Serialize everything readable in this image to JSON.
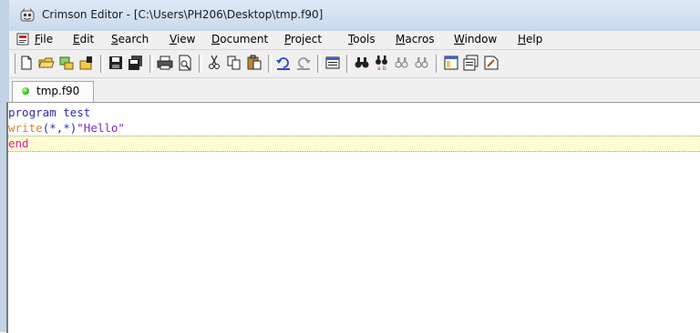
{
  "window": {
    "title": "Crimson Editor - [C:\\Users\\PH206\\Desktop\\tmp.f90]"
  },
  "menu": [
    {
      "label": "File",
      "accel": "F",
      "rest": "ile"
    },
    {
      "label": "Edit",
      "accel": "E",
      "rest": "dit"
    },
    {
      "label": "Search",
      "accel": "S",
      "rest": "earch"
    },
    {
      "label": "View",
      "accel": "V",
      "rest": "iew"
    },
    {
      "label": "Document",
      "accel": "D",
      "rest": "ocument"
    },
    {
      "label": "Project",
      "accel": "P",
      "rest": "roject"
    },
    {
      "label": "Tools",
      "accel": "T",
      "rest": "ools"
    },
    {
      "label": "Macros",
      "accel": "M",
      "rest": "acros"
    },
    {
      "label": "Window",
      "accel": "W",
      "rest": "indow"
    },
    {
      "label": "Help",
      "accel": "H",
      "rest": "elp"
    }
  ],
  "toolbar": {
    "icons": [
      "new-file-icon",
      "open-folder-icon",
      "open-remote-icon",
      "open-template-icon",
      "save-icon",
      "save-all-icon",
      "print-icon",
      "print-preview-icon",
      "cut-icon",
      "copy-icon",
      "paste-icon",
      "undo-icon",
      "redo-icon",
      "toggle-column-icon",
      "find-icon",
      "replace-icon",
      "find-next-icon",
      "find-prev-icon",
      "directory-window-icon",
      "output-window-icon",
      "macro-icon"
    ]
  },
  "tabs": [
    {
      "label": "tmp.f90",
      "status_color": "#2fbf1a"
    }
  ],
  "editor": {
    "lines": [
      {
        "kw": "program",
        "rest": " test"
      },
      {
        "fn": "write",
        "paren": "(*,*)",
        "str": "\"Hello\""
      },
      {
        "kw": "end"
      }
    ],
    "colors": {
      "keyword": "#2b2bb0",
      "function": "#d3862f",
      "string": "#7a2ac8",
      "end_keyword": "#e01ea0",
      "current_line_bg": "#fffbd3"
    }
  }
}
